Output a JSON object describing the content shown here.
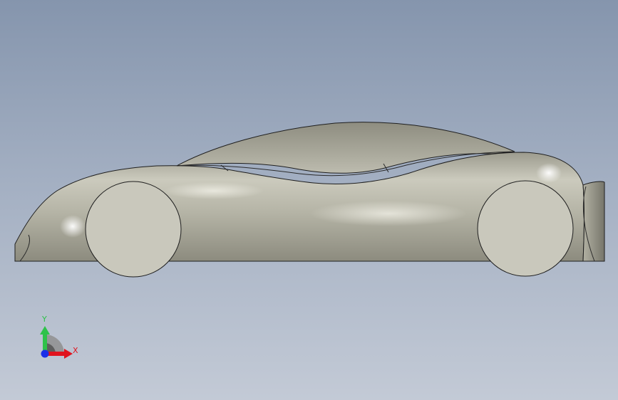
{
  "viewport": {
    "background_top": "#8595ad",
    "background_bottom": "#c3cad6"
  },
  "model": {
    "body_color": "#b9b8aa",
    "wheel_color": "#c9c8bc",
    "outline_color": "#1e1e1e"
  },
  "triad": {
    "y_label": "Y",
    "x_label": "X",
    "y_color": "#2ec24a",
    "x_color": "#e0141e",
    "z_color": "#1a2ee8"
  }
}
